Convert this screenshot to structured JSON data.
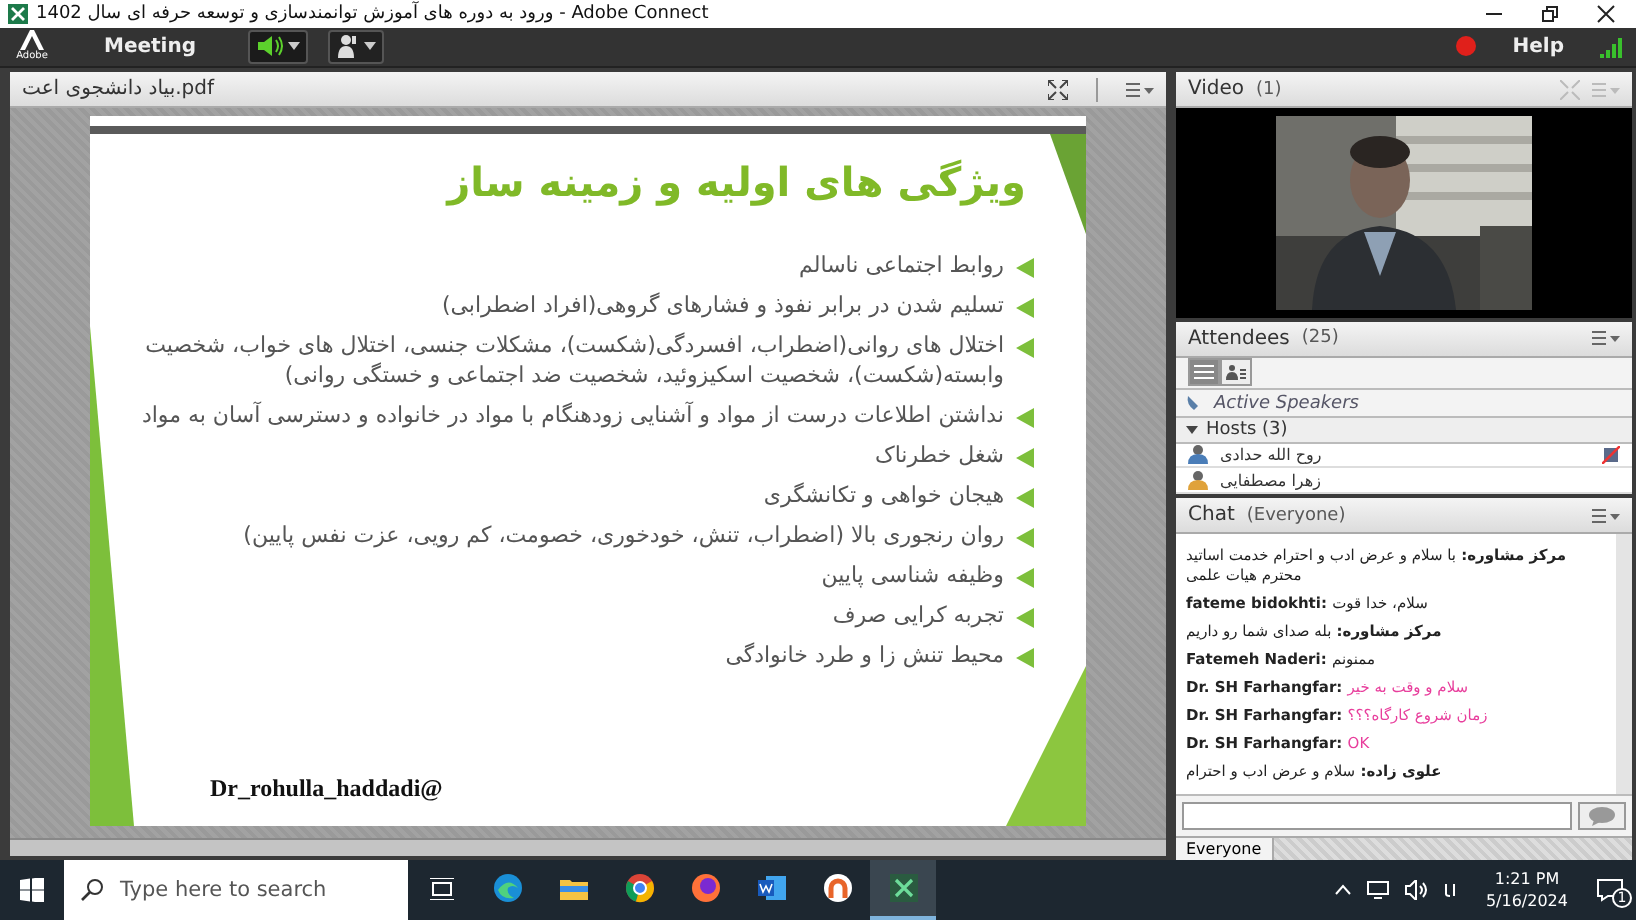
{
  "window": {
    "title": "ورود به دوره های آموزش توانمندسازی و توسعه حرفه ای سال 1402 - Adobe Connect"
  },
  "meeting_bar": {
    "logo": "Adobe",
    "menu": "Meeting",
    "speaker": {
      "on": true
    },
    "recording": {
      "on": true
    },
    "help": "Help"
  },
  "share_pod": {
    "file_name": "بیاد دانشجوی اعت.pdf",
    "slide": {
      "title": "ویژگی های اولیه و زمینه ساز",
      "signature": "Dr_rohulla_haddadi@",
      "bullets": [
        "روابط اجتماعی ناسالم",
        "تسلیم شدن در برابر نفوذ و فشارهای گروهی(افراد اضطرابی)",
        "اختلال های روانی(اضطراب، افسردگی(شکست)، مشکلات جنسی، اختلال های خواب، شخصیت وابسته(شکست)، شخصیت اسکیزوئید، شخصیت ضد اجتماعی و خستگی روانی)",
        "نداشتن اطلاعات درست از مواد و آشنایی زودهنگام با مواد در خانواده و دسترسی آسان به مواد",
        "شغل خطرناک",
        "هیجان خواهی و تکانشگری",
        "روان رنجوری بالا (اضطراب، تنش، خودخوری، خصومت، کم رویی، عزت نفس پایین)",
        "وظیفه شناسی پایین",
        "تجربه کرایی صرف",
        "محیط تنش زا و طرد خانوادگی"
      ]
    }
  },
  "video_pod": {
    "title": "Video",
    "count": "(1)"
  },
  "attendees_pod": {
    "title": "Attendees",
    "count": "(25)",
    "view_buttons": [
      {
        "selected": true
      },
      {
        "selected": false
      }
    ],
    "active_speakers": "Active Speakers",
    "groups": [
      {
        "label": "Hosts (3)",
        "expanded": true,
        "members": [
          {
            "name": "روح الله حدادی",
            "presenter": true
          },
          {
            "name": "زهرا مصطفایی",
            "presenter": false
          }
        ]
      }
    ]
  },
  "chat_pod": {
    "title": "Chat",
    "scope": "(Everyone)",
    "messages": [
      {
        "sender": "مرکز مشاوره:",
        "text": "با سلام و عرض ادب و احترام خدمت اساتید محترم هیات علمی",
        "color": "#222222"
      },
      {
        "sender": "fateme bidokhti:",
        "text": "سلام، خدا قوت",
        "color": "#222222"
      },
      {
        "sender": "مرکز مشاوره:",
        "text": "بله صدای شما رو داریم",
        "color": "#222222"
      },
      {
        "sender": "Fatemeh Naderi:",
        "text": "ممنونم",
        "color": "#222222"
      },
      {
        "sender": "Dr. SH Farhangfar:",
        "text": "سلام و وقت به خیر",
        "color": "#e83e9c"
      },
      {
        "sender": "Dr. SH Farhangfar:",
        "text": "زمان شروع کارگاه؟؟؟",
        "color": "#e83e9c"
      },
      {
        "sender": "Dr. SH Farhangfar:",
        "text": "OK",
        "color": "#e83e9c"
      },
      {
        "sender": "علوی زاده:",
        "text": "سلام و عرض ادب و احترام",
        "color": "#222222"
      }
    ],
    "tab": "Everyone"
  },
  "taskbar": {
    "search": {
      "placeholder": "Type here to search"
    },
    "apps": [
      {
        "kind": "edge",
        "selected": false
      },
      {
        "kind": "folder",
        "selected": false
      },
      {
        "kind": "chrome",
        "selected": false
      },
      {
        "kind": "firefox",
        "selected": false
      },
      {
        "kind": "word",
        "selected": false
      },
      {
        "kind": "ring",
        "selected": false
      },
      {
        "kind": "connect",
        "selected": true
      }
    ],
    "time": "1:21 PM",
    "date": "5/16/2024",
    "notifications": "1"
  }
}
